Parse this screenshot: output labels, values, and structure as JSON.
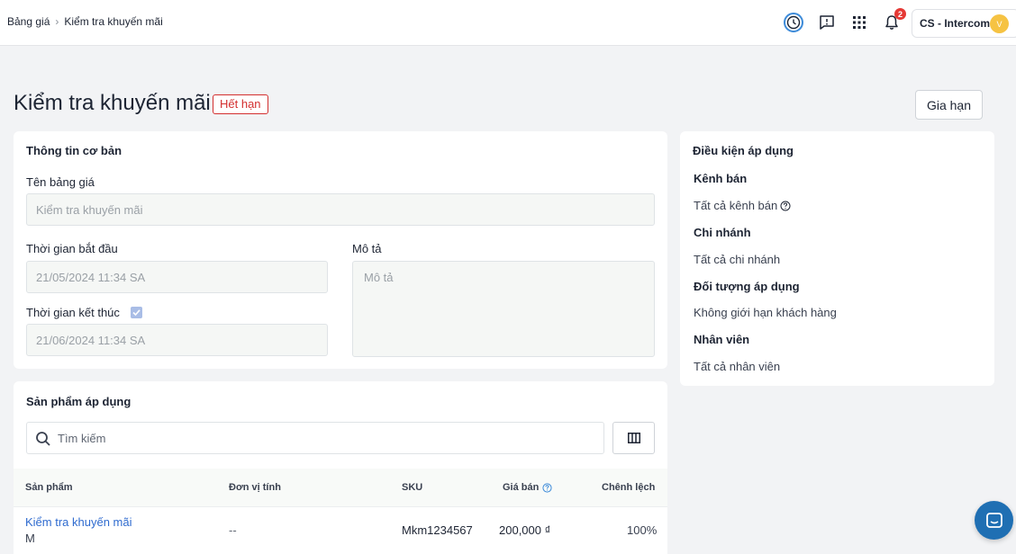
{
  "breadcrumb": {
    "parent": "Bảng giá",
    "current": "Kiểm tra khuyến mãi"
  },
  "topbar": {
    "notifications_count": "2",
    "account_name": "CS - Intercom",
    "avatar_initial": "V"
  },
  "page": {
    "title": "Kiểm tra khuyến mãi",
    "status": "Hết hạn",
    "renew_label": "Gia hạn"
  },
  "basic_info": {
    "title": "Thông tin cơ bản",
    "name_label": "Tên bảng giá",
    "name_value": "Kiểm tra khuyến mãi",
    "start_label": "Thời gian bắt đầu",
    "start_value": "21/05/2024 11:34 SA",
    "end_label": "Thời gian kết thúc",
    "end_checked": true,
    "end_value": "21/06/2024 11:34 SA",
    "desc_label": "Mô tả",
    "desc_placeholder": "Mô tả"
  },
  "conditions": {
    "title": "Điều kiện áp dụng",
    "sales_channel_label": "Kênh bán",
    "sales_channel_value": "Tất cả kênh bán",
    "branch_label": "Chi nhánh",
    "branch_value": "Tất cả chi nhánh",
    "target_label": "Đối tượng áp dụng",
    "target_value": "Không giới hạn khách hàng",
    "staff_label": "Nhân viên",
    "staff_value": "Tất cả nhân viên"
  },
  "products": {
    "title": "Sản phẩm áp dụng",
    "search_placeholder": "Tìm kiếm",
    "columns": [
      "Sản phẩm",
      "Đơn vị tính",
      "SKU",
      "Giá bán",
      "Chênh lệch"
    ],
    "rows": [
      {
        "name": "Kiểm tra khuyến mãi",
        "variant": "M",
        "unit": "--",
        "sku": "Mkm1234567",
        "price": "200,000 ₫",
        "diff": "100%"
      }
    ]
  },
  "colors": {
    "accent": "#2f6bcf",
    "danger": "#d32f2f",
    "fab": "#1f6fb3"
  }
}
